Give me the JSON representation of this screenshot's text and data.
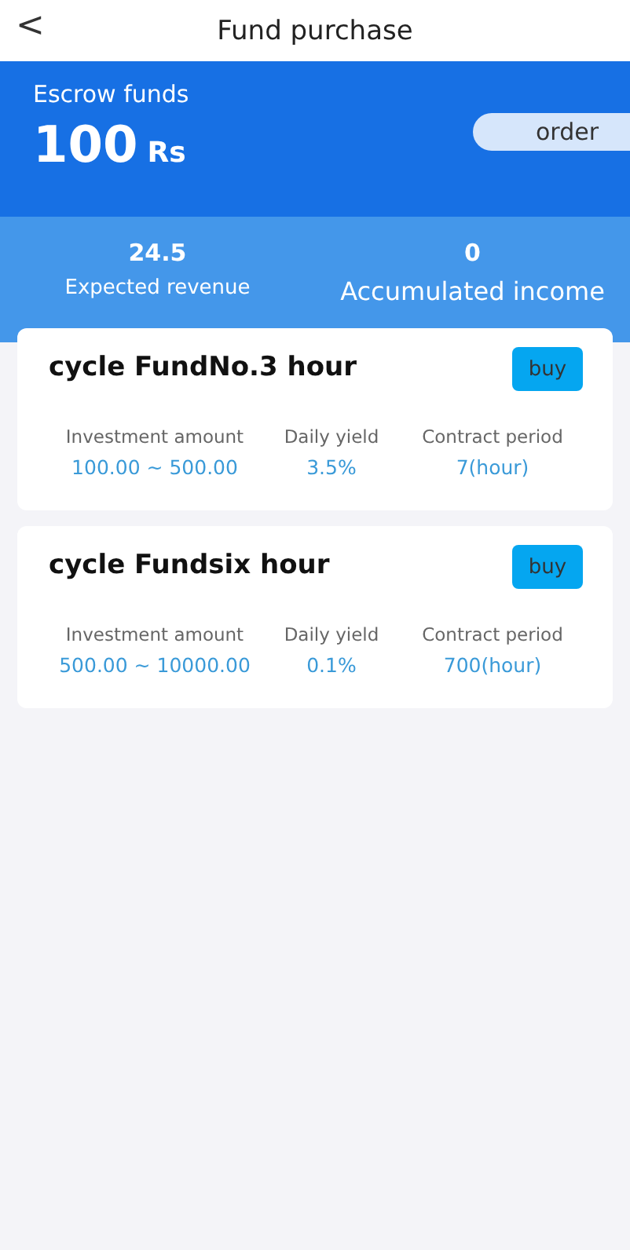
{
  "header": {
    "back": "<",
    "title": "Fund purchase"
  },
  "escrow": {
    "label": "Escrow funds",
    "amount": "100",
    "unit": "Rs",
    "order_button": "order"
  },
  "stats": [
    {
      "value": "24.5",
      "label": "Expected revenue"
    },
    {
      "value": "0",
      "label": "Accumulated income"
    }
  ],
  "funds": [
    {
      "name": "cycle FundNo.3 hour",
      "button": "buy",
      "fields": [
        {
          "label": "Investment amount",
          "value": "100.00 ~ 500.00"
        },
        {
          "label": "Daily yield",
          "value": "3.5%"
        },
        {
          "label": "Contract period",
          "value": "7(hour)"
        }
      ]
    },
    {
      "name": "cycle Fundsix hour",
      "button": "buy",
      "fields": [
        {
          "label": "Investment amount",
          "value": "500.00 ~ 10000.00"
        },
        {
          "label": "Daily yield",
          "value": "0.1%"
        },
        {
          "label": "Contract period",
          "value": "700(hour)"
        }
      ]
    }
  ]
}
